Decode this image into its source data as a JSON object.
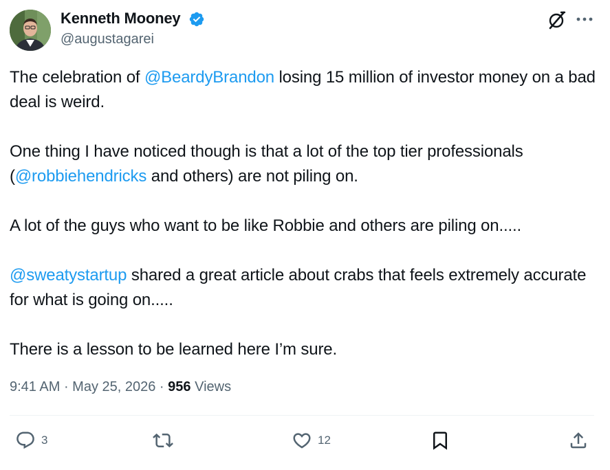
{
  "author": {
    "name": "Kenneth Mooney",
    "handle": "@augustagarei"
  },
  "tweet": {
    "p1_pre": "The celebration of ",
    "p1_mention": "@BeardyBrandon",
    "p1_post": " losing 15 million of investor money on a bad deal is weird.",
    "p2_pre": "One thing I have noticed though is that a lot of the top tier professionals (",
    "p2_mention": "@robbiehendricks",
    "p2_post": " and others) are not piling on.",
    "p3": "A lot of the guys who want to be like Robbie and others are piling on.....",
    "p4_mention": "@sweatystartup",
    "p4_post": " shared a great article about crabs that feels extremely accurate for what is going on.....",
    "p5": "There is a lesson to be learned here I’m sure."
  },
  "meta": {
    "time": "9:41 AM",
    "sep1": " · ",
    "date": "May 25, 2026",
    "sep2": " · ",
    "views_count": "956",
    "views_label": " Views"
  },
  "actions": {
    "replies": "3",
    "likes": "12"
  },
  "icons": [
    "verified-badge-icon",
    "grok-icon",
    "more-icon",
    "reply-icon",
    "retweet-icon",
    "like-icon",
    "bookmark-icon",
    "share-icon"
  ],
  "colors": {
    "link": "#1d9bf0",
    "secondary_text": "#536471",
    "primary_text": "#0f1419",
    "verified": "#1d9bf0"
  }
}
